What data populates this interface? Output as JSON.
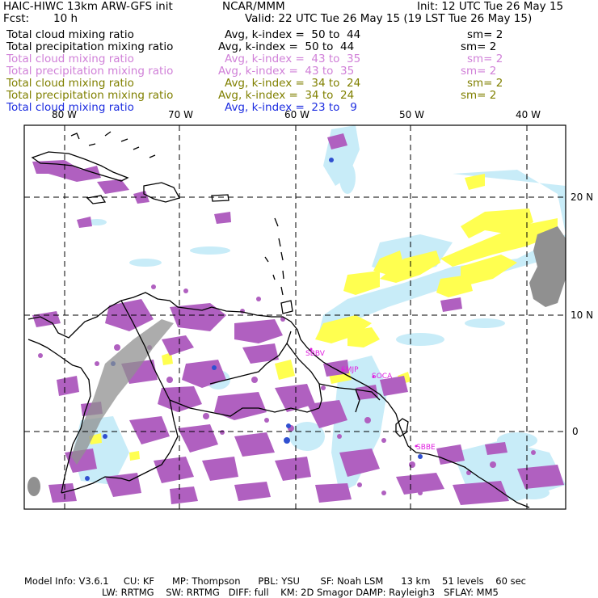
{
  "header": {
    "model": "HAIC-HIWC 13km ARW-GFS init",
    "org": "NCAR/MMM",
    "init": "Init: 12 UTC Tue 26 May 15",
    "fcst_label": "Fcst:",
    "fcst_value": "10 h",
    "valid": "Valid: 22 UTC Tue 26 May 15 (19 LST Tue 26 May 15)"
  },
  "legend": [
    {
      "label": "Total cloud mixing ratio",
      "avg": "Avg, k-index =  50 to  44",
      "sm": "sm= 2",
      "color": "#000000"
    },
    {
      "label": "Total precipitation mixing ratio",
      "avg": "Avg, k-index =  50 to  44",
      "sm": "sm= 2",
      "color": "#000000"
    },
    {
      "label": "Total cloud mixing ratio",
      "avg": "Avg, k-index =  43 to  35",
      "sm": "sm= 2",
      "color": "#d080d8"
    },
    {
      "label": "Total precipitation mixing ratio",
      "avg": "Avg, k-index =  43 to  35",
      "sm": "sm= 2",
      "color": "#d080d8"
    },
    {
      "label": "Total cloud mixing ratio",
      "avg": "Avg, k-index =  34 to  24",
      "sm": "sm= 2",
      "color": "#808000"
    },
    {
      "label": "Total precipitation mixing ratio",
      "avg": "Avg, k-index =  34 to  24",
      "sm": "sm= 2",
      "color": "#808000"
    },
    {
      "label": "Total cloud mixing ratio",
      "avg": "Avg, k-index =  23 to   9",
      "sm": "",
      "color": "#1e2ee0"
    }
  ],
  "map": {
    "lon_labels": [
      "80 W",
      "70 W",
      "60 W",
      "50 W",
      "40 W"
    ],
    "lat_labels": [
      "20 N",
      "10 N",
      "0"
    ],
    "stations": [
      "SBBV",
      "SMJP",
      "SOCA",
      "SBBE"
    ],
    "colors": {
      "purple": "#b060c0",
      "yellow": "#ffff50",
      "lightblue": "#c8ecf8",
      "blue": "#3050d0",
      "gray": "#909090"
    }
  },
  "footer": {
    "line1": "Model Info: V3.6.1     CU: KF      MP: Thompson      PBL: YSU       SF: Noah LSM      13 km    51 levels    60 sec",
    "line2": "LW: RRTMG    SW: RRTMG   DIFF: full    KM: 2D Smagor DAMP: Rayleigh3   SFLAY: MM5"
  }
}
